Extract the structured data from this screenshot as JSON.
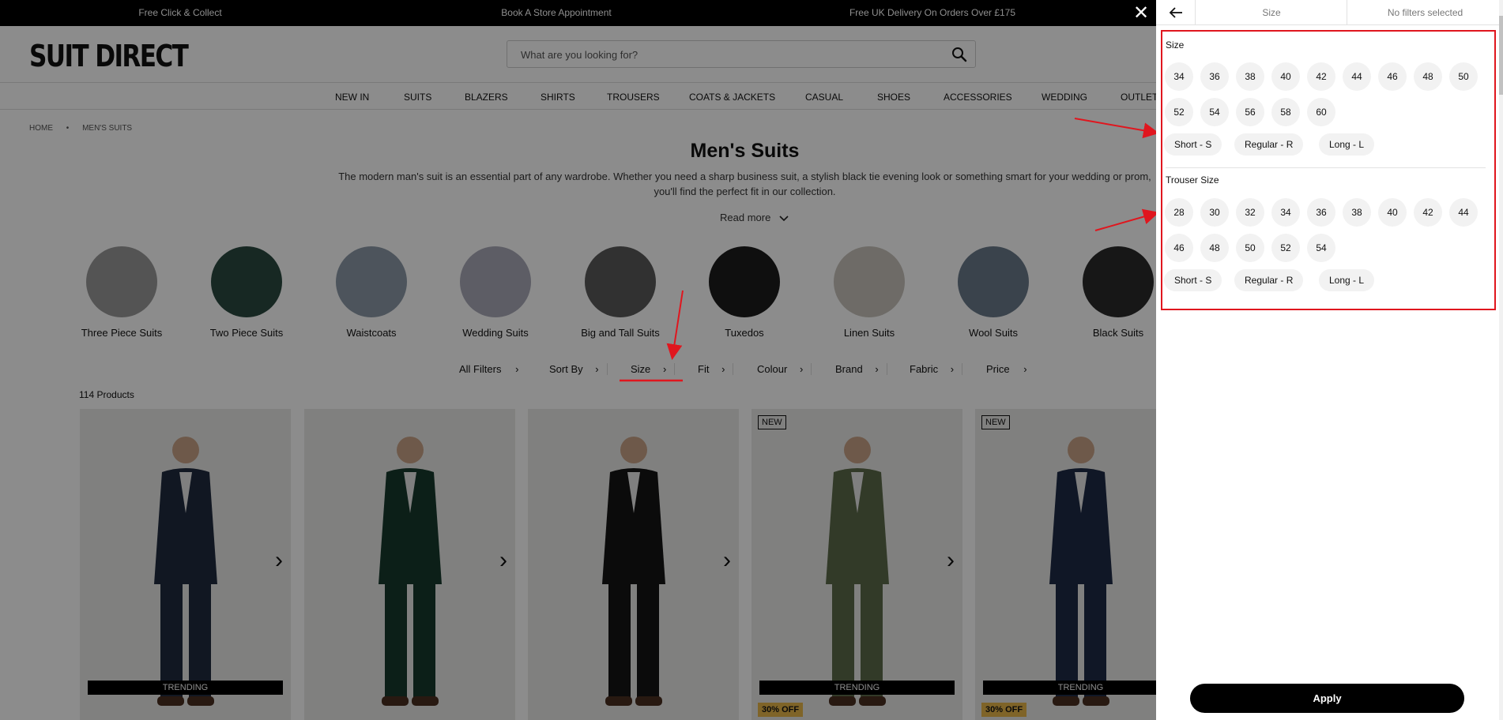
{
  "promo": [
    "Free Click & Collect",
    "Book A Store Appointment",
    "Free UK Delivery On Orders Over £175"
  ],
  "header": {
    "logo": "SUIT DIRECT",
    "search_placeholder": "What are you looking for?"
  },
  "nav": [
    "NEW IN",
    "SUITS",
    "BLAZERS",
    "SHIRTS",
    "TROUSERS",
    "COATS & JACKETS",
    "CASUAL",
    "SHOES",
    "ACCESSORIES",
    "WEDDING",
    "OUTLET"
  ],
  "breadcrumb": [
    "HOME",
    "•",
    "MEN'S SUITS"
  ],
  "page": {
    "title": "Men's Suits",
    "intro": "The modern man's suit is an essential part of any wardrobe. Whether you need a sharp business suit, a stylish black tie evening look or something smart for your wedding or prom, you'll find the perfect fit in our collection.",
    "read_more": "Read more",
    "product_count": "114 Products"
  },
  "categories": [
    "Three Piece Suits",
    "Two Piece Suits",
    "Waistcoats",
    "Wedding Suits",
    "Big and Tall Suits",
    "Tuxedos",
    "Linen Suits",
    "Wool Suits",
    "Black Suits"
  ],
  "filters": [
    "All Filters",
    "Sort By",
    "Size",
    "Fit",
    "Colour",
    "Brand",
    "Fabric",
    "Price"
  ],
  "products": [
    {
      "badge": "",
      "tag": "TRENDING",
      "offer": "",
      "suit_color": "#1f2a3e"
    },
    {
      "badge": "",
      "tag": "",
      "offer": "",
      "suit_color": "#173a2c"
    },
    {
      "badge": "",
      "tag": "",
      "offer": "",
      "suit_color": "#151515"
    },
    {
      "badge": "NEW",
      "tag": "TRENDING",
      "offer": "30% OFF",
      "suit_color": "#5b6a4a"
    },
    {
      "badge": "NEW",
      "tag": "TRENDING",
      "offer": "30% OFF",
      "suit_color": "#1e2b45"
    }
  ],
  "panel": {
    "tab_label": "Size",
    "status": "No filters selected",
    "size_title": "Size",
    "size_values": [
      "34",
      "36",
      "38",
      "40",
      "42",
      "44",
      "46",
      "48",
      "50",
      "52",
      "54",
      "56",
      "58",
      "60"
    ],
    "size_lengths": [
      "Short - S",
      "Regular - R",
      "Long - L"
    ],
    "trouser_title": "Trouser Size",
    "trouser_values": [
      "28",
      "30",
      "32",
      "34",
      "36",
      "38",
      "40",
      "42",
      "44",
      "46",
      "48",
      "50",
      "52",
      "54"
    ],
    "trouser_lengths": [
      "Short - S",
      "Regular - R",
      "Long - L"
    ],
    "apply": "Apply"
  },
  "colors": {
    "annotation_red": "#e0161e",
    "offer_badge": "#e8b74a"
  }
}
